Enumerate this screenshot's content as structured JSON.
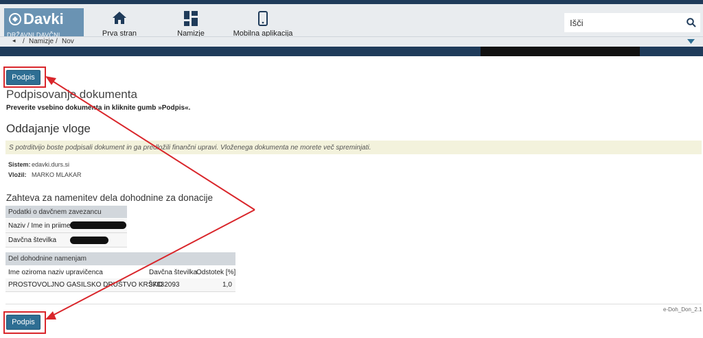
{
  "header": {
    "logo_name": "Davki",
    "logo_sub": "DRŽAVNI DAVČNI PORTAL",
    "nav": [
      {
        "label": "Prva stran",
        "icon": "home-icon"
      },
      {
        "label": "Namizje",
        "icon": "dashboard-icon"
      },
      {
        "label": "Mobilna aplikacija",
        "icon": "mobile-icon"
      }
    ],
    "search_text": "Išči"
  },
  "breadcrumb": {
    "items": [
      "Namizje",
      "Nov"
    ],
    "separator": "/"
  },
  "buttons": {
    "sign_label": "Podpis"
  },
  "content": {
    "title": "Podpisovanje dokumenta",
    "instruction": "Preverite vsebino dokumenta in kliknite gumb »Podpis«.",
    "section_title": "Oddajanje vloge",
    "notice": "S potrditvijo boste podpisali dokument in ga predložili finančni upravi. Vloženega dokumenta ne morete več spreminjati.",
    "meta": [
      {
        "label": "Sistem:",
        "value": "edavki.durs.si"
      },
      {
        "label": "Vložil:",
        "value": "MARKO MLAKAR"
      }
    ],
    "request_title": "Zahteva za namenitev dela dohodnine za donacije"
  },
  "taxpayer_table": {
    "header": "Podatki o davčnem zavezancu",
    "rows": [
      {
        "label": "Naziv / Ime in priimek"
      },
      {
        "label": "Davčna številka"
      }
    ]
  },
  "income_table": {
    "header": "Del dohodnine namenjam",
    "columns": [
      "Ime oziroma naziv upravičenca",
      "Davčna številka",
      "Odstotek [%]"
    ],
    "rows": [
      [
        "PROSTOVOLJNO GASILSKO DRUŠTVO KRŠKO",
        "37832093",
        "1,0"
      ]
    ]
  },
  "footer": {
    "code": "e-Doh_Don_2.1"
  },
  "colors": {
    "accent": "#2e6e93",
    "header_bg": "#e9ecef",
    "dark_bar": "#1f3b5a",
    "annotation": "#d9262b",
    "notice_bg": "#f3f2dc"
  }
}
